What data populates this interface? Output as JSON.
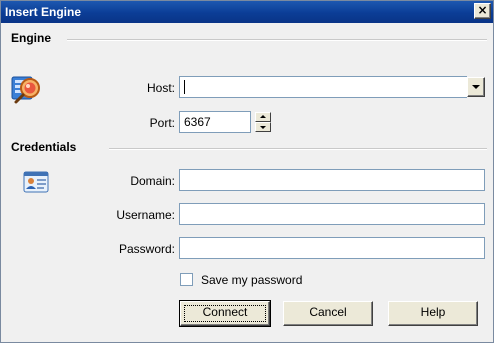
{
  "window": {
    "title": "Insert Engine",
    "close_glyph": "×"
  },
  "engine_section": {
    "title": "Engine",
    "icon": "engine-search-icon",
    "host": {
      "label": "Host:",
      "value": ""
    },
    "port": {
      "label": "Port:",
      "value": "6367"
    }
  },
  "credentials_section": {
    "title": "Credentials",
    "icon": "id-card-icon",
    "domain": {
      "label": "Domain:",
      "value": ""
    },
    "username": {
      "label": "Username:",
      "value": ""
    },
    "password": {
      "label": "Password:",
      "value": ""
    },
    "save_password": {
      "label": "Save my password",
      "checked": false
    }
  },
  "buttons": {
    "connect": "Connect",
    "cancel": "Cancel",
    "help": "Help"
  },
  "colors": {
    "titlebar": "#0b3d96",
    "dialog_bg": "#f0f0f0",
    "field_border": "#7f9db9"
  }
}
